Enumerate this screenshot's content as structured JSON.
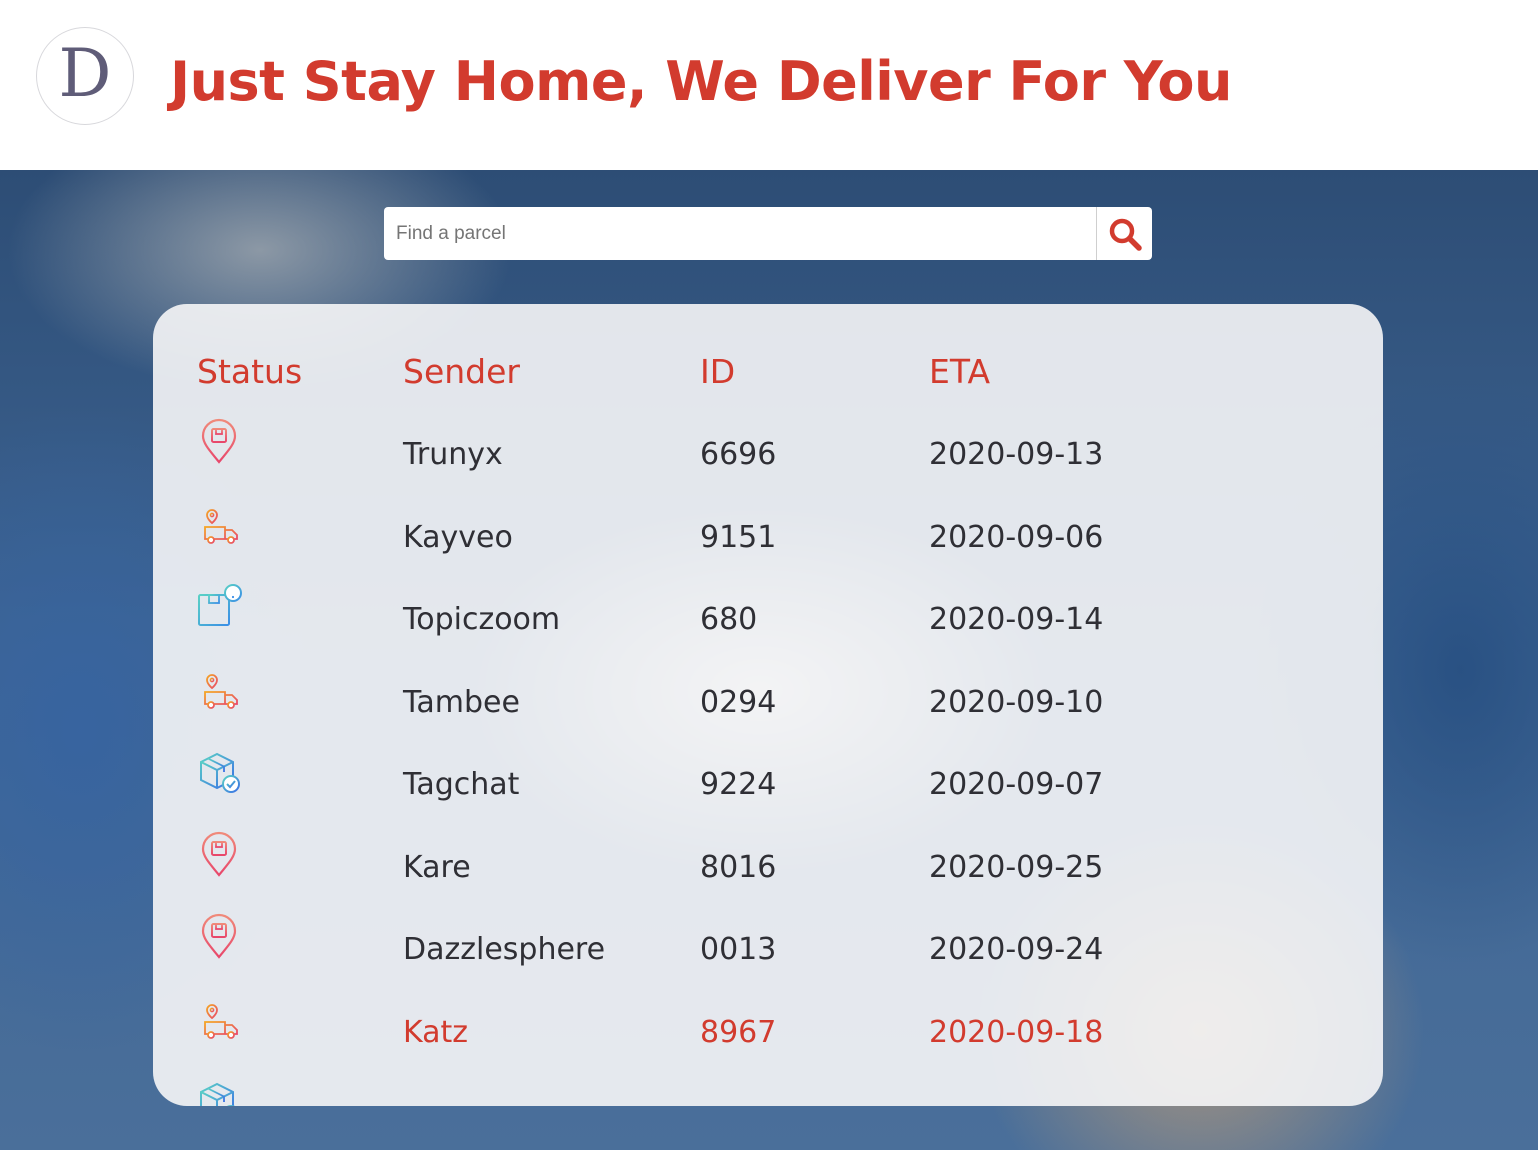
{
  "header": {
    "logo_letter": "D",
    "title": "Just Stay Home, We Deliver For You"
  },
  "search": {
    "placeholder": "Find a parcel",
    "value": "",
    "button_icon": "search-icon"
  },
  "table": {
    "columns": [
      "Status",
      "Sender",
      "ID",
      "ETA"
    ],
    "rows": [
      {
        "status": "location-pin-parcel-icon",
        "sender": "Trunyx",
        "id": "6696",
        "eta": "2020-09-13",
        "highlight": false
      },
      {
        "status": "delivery-truck-icon",
        "sender": "Kayveo",
        "id": "9151",
        "eta": "2020-09-06",
        "highlight": false
      },
      {
        "status": "parcel-alert-icon",
        "sender": "Topiczoom",
        "id": "680",
        "eta": "2020-09-14",
        "highlight": false
      },
      {
        "status": "delivery-truck-icon",
        "sender": "Tambee",
        "id": "0294",
        "eta": "2020-09-10",
        "highlight": false
      },
      {
        "status": "parcel-delivered-icon",
        "sender": "Tagchat",
        "id": "9224",
        "eta": "2020-09-07",
        "highlight": false
      },
      {
        "status": "location-pin-parcel-icon",
        "sender": "Kare",
        "id": "8016",
        "eta": "2020-09-25",
        "highlight": false
      },
      {
        "status": "location-pin-parcel-icon",
        "sender": "Dazzlesphere",
        "id": "0013",
        "eta": "2020-09-24",
        "highlight": false
      },
      {
        "status": "delivery-truck-icon",
        "sender": "Katz",
        "id": "8967",
        "eta": "2020-09-18",
        "highlight": true
      },
      {
        "status": "parcel-delivered-icon",
        "sender": "",
        "id": "",
        "eta": "",
        "highlight": false
      }
    ]
  },
  "colors": {
    "accent": "#d23b2e",
    "text": "#2f2f35"
  }
}
